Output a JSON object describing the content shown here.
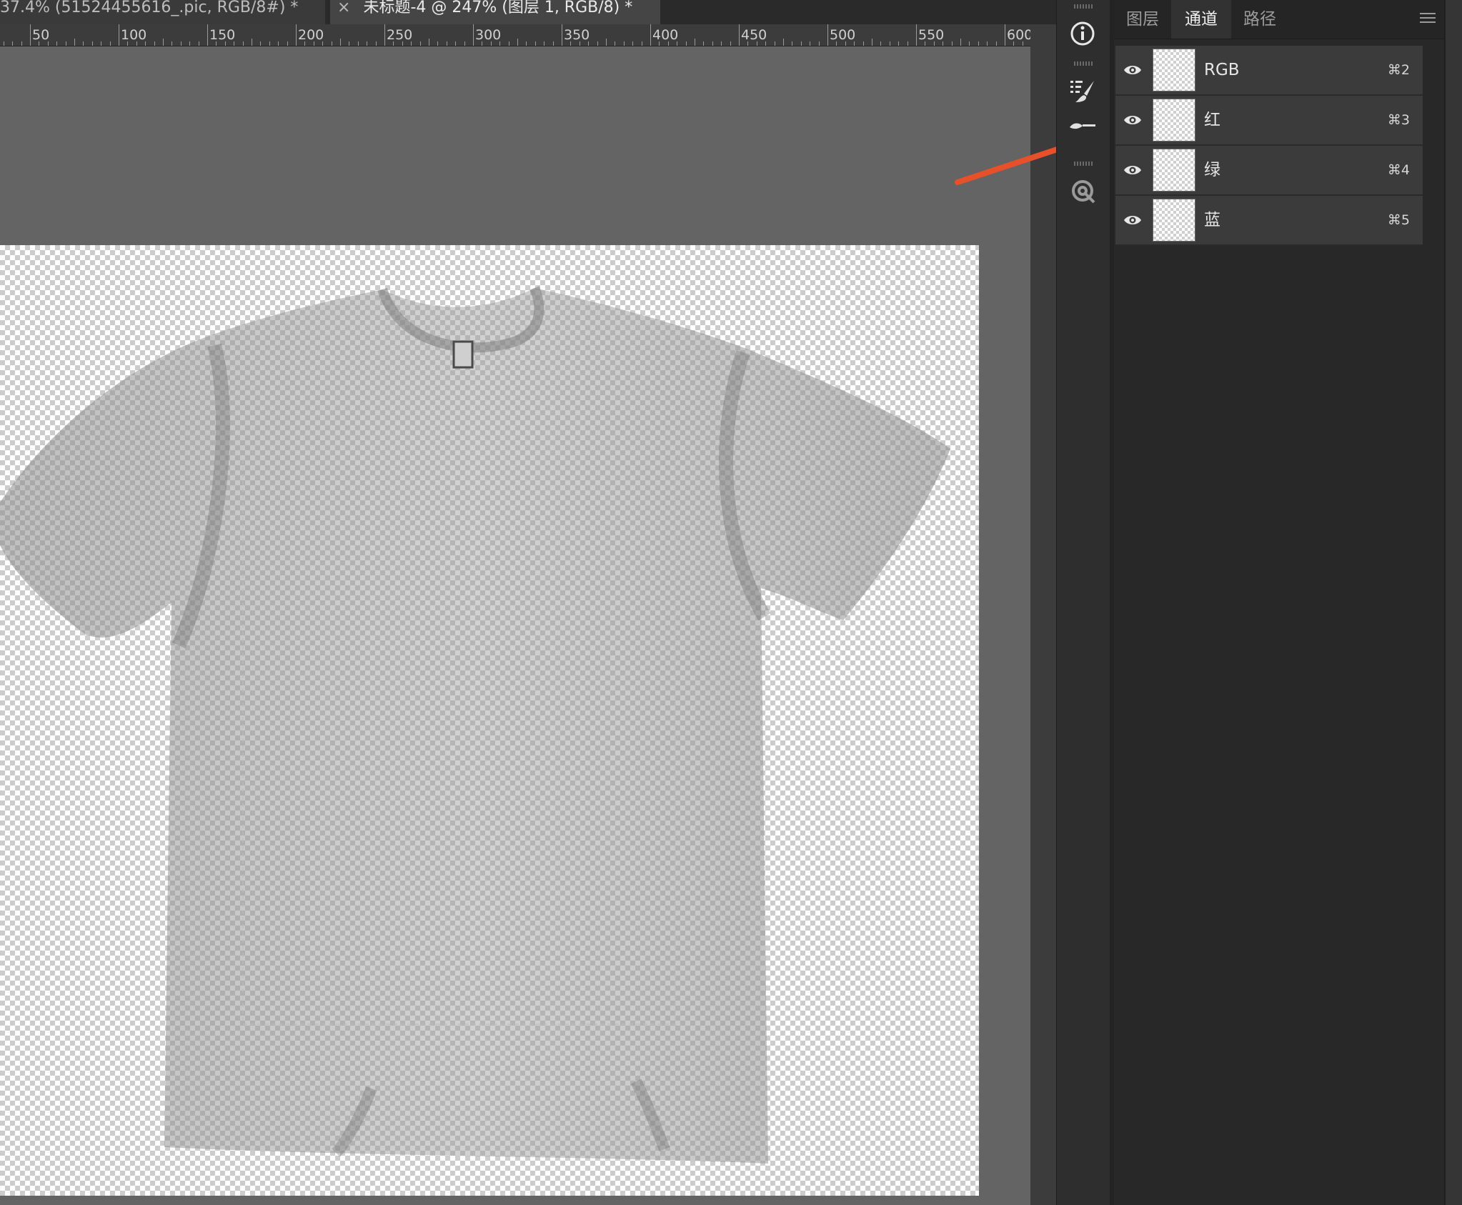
{
  "document_tabs": [
    {
      "title": "37.4% (51524455616_.pic, RGB/8#) *"
    },
    {
      "title": "未标题-4 @ 247% (图层 1, RGB/8) *",
      "close_glyph": "×"
    }
  ],
  "ruler": {
    "labels": [
      "50",
      "100",
      "150",
      "200",
      "250",
      "300",
      "350",
      "400",
      "450",
      "500",
      "550",
      "600"
    ]
  },
  "panel": {
    "tabs": [
      "图层",
      "通道",
      "路径"
    ],
    "active_tab": "通道",
    "channels": [
      {
        "name": "RGB",
        "shortcut": "⌘2",
        "visible": true
      },
      {
        "name": "红",
        "shortcut": "⌘3",
        "visible": true
      },
      {
        "name": "绿",
        "shortcut": "⌘4",
        "visible": true
      },
      {
        "name": "蓝",
        "shortcut": "⌘5",
        "visible": true
      }
    ]
  },
  "colors": {
    "annotation_arrow": "#e8502a",
    "canvas_bg": "#646464",
    "panel_bg": "#282828"
  },
  "icons": [
    "info-icon",
    "brush-presets-icon",
    "brush-icon",
    "libraries-icon",
    "eye-icon",
    "panel-menu-icon",
    "close-icon"
  ]
}
